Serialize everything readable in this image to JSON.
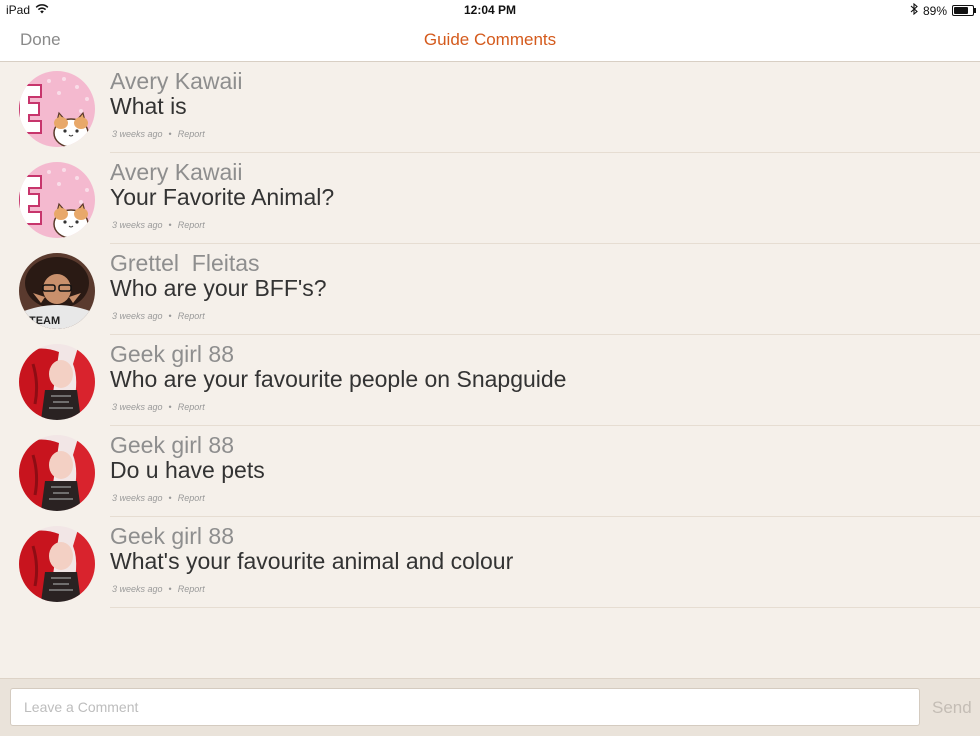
{
  "status_bar": {
    "device": "iPad",
    "time": "12:04 PM",
    "battery": "89%",
    "battery_level": 0.89
  },
  "nav": {
    "done_label": "Done",
    "title": "Guide Comments",
    "accent_color": "#d45a1c"
  },
  "comments": [
    {
      "author": "Avery Kawaii",
      "text": "What is",
      "time": "3 weeks ago",
      "report": "Report",
      "avatar": "kitten-avatar"
    },
    {
      "author": "Avery Kawaii",
      "text": "Your Favorite Animal?",
      "time": "3 weeks ago",
      "report": "Report",
      "avatar": "kitten-avatar"
    },
    {
      "author": "Grettel  Fleitas",
      "text": "Who are your BFF's?",
      "time": "3 weeks ago",
      "report": "Report",
      "avatar": "person-avatar"
    },
    {
      "author": "Geek girl 88",
      "text": "Who are your favourite people on Snapguide",
      "time": "3 weeks ago",
      "report": "Report",
      "avatar": "red-hair-avatar"
    },
    {
      "author": "Geek girl 88",
      "text": "Do u have pets",
      "time": "3 weeks ago",
      "report": "Report",
      "avatar": "red-hair-avatar"
    },
    {
      "author": "Geek girl 88",
      "text": "What's your favourite animal and colour",
      "time": "3 weeks ago",
      "report": "Report",
      "avatar": "red-hair-avatar"
    }
  ],
  "composer": {
    "placeholder": "Leave a Comment",
    "value": "",
    "send_label": "Send"
  }
}
